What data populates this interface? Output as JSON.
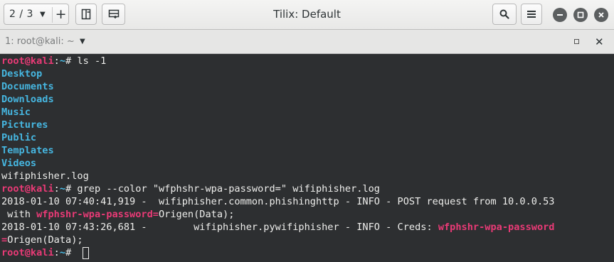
{
  "header": {
    "session_label": "2 / 3",
    "session_dropdown_icon": "chevron-down-icon",
    "new_session_icon": "plus-icon",
    "add_terminal_right_icon": "add-terminal-right-icon",
    "add_terminal_down_icon": "add-terminal-down-icon",
    "title": "Tilix: Default",
    "search_icon": "search-icon",
    "menu_icon": "hamburger-menu-icon",
    "window_buttons": [
      "minimize-icon",
      "maximize-icon",
      "close-icon"
    ]
  },
  "tab": {
    "title": "1: root@kali: ~"
  },
  "terminal": {
    "prompt": {
      "user_host": "root@kali",
      "sep": ":",
      "path": "~",
      "symbol": "# "
    },
    "cmd1": "ls -1",
    "dirs": [
      "Desktop",
      "Documents",
      "Downloads",
      "Music",
      "Pictures",
      "Public",
      "Templates",
      "Videos"
    ],
    "file": "wifiphisher.log",
    "cmd2": "grep --color \"wfphshr-wpa-password=\" wifiphisher.log",
    "out1_a": "2018-01-10 07:40:41,919 -  wifiphisher.common.phishinghttp - INFO - POST request from 10.0.0.53",
    "out1_b_pre": " with ",
    "match": "wfphshr-wpa-password",
    "match_eq": "wfphshr-wpa-password=",
    "out1_b_post": "Origen(Data);",
    "out2_a_pre": "2018-01-10 07:43:26,681 -        wifiphisher.pywifiphisher - INFO - Creds: ",
    "out2_b_eq": "=",
    "out2_b_post": "Origen(Data);"
  },
  "colors": {
    "prompt_user": "#e93a76",
    "prompt_path": "#49bde6",
    "directory": "#46b6e0",
    "grep_match": "#e93a76",
    "terminal_bg": "#2d2f31",
    "terminal_fg": "#eeeeec"
  }
}
